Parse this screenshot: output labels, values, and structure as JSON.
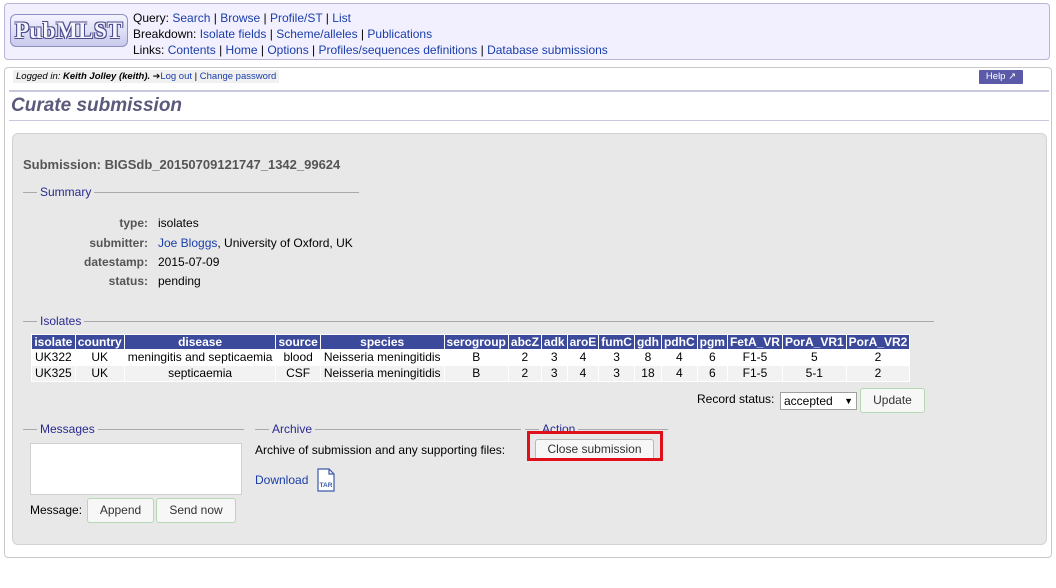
{
  "header": {
    "logo_text": "PubMLST",
    "query_label": "Query:",
    "query_links": [
      "Search",
      "Browse",
      "Profile/ST",
      "List"
    ],
    "breakdown_label": "Breakdown:",
    "breakdown_links": [
      "Isolate fields",
      "Scheme/alleles",
      "Publications"
    ],
    "links_label": "Links:",
    "links_links": [
      "Contents",
      "Home",
      "Options",
      "Profiles/sequences definitions",
      "Database submissions"
    ]
  },
  "userbar": {
    "logged_in_label": "Logged in:",
    "user": "Keith Jolley (keith).",
    "logout": "Log out",
    "change_password": "Change password"
  },
  "help_label": "Help",
  "page_title": "Curate submission",
  "submission_title": "Submission: BIGSdb_20150709121747_1342_99624",
  "summary": {
    "legend": "Summary",
    "type_label": "type:",
    "type_value": "isolates",
    "submitter_label": "submitter:",
    "submitter_name": "Joe Bloggs",
    "submitter_affiliation": ", University of Oxford, UK",
    "datestamp_label": "datestamp:",
    "datestamp_value": "2015-07-09",
    "status_label": "status:",
    "status_value": "pending"
  },
  "isolates": {
    "legend": "Isolates",
    "columns": [
      "isolate",
      "country",
      "disease",
      "source",
      "species",
      "serogroup",
      "abcZ",
      "adk",
      "aroE",
      "fumC",
      "gdh",
      "pdhC",
      "pgm",
      "FetA_VR",
      "PorA_VR1",
      "PorA_VR2"
    ],
    "rows": [
      [
        "UK322",
        "UK",
        "meningitis and septicaemia",
        "blood",
        "Neisseria meningitidis",
        "B",
        "2",
        "3",
        "4",
        "3",
        "8",
        "4",
        "6",
        "F1-5",
        "5",
        "2"
      ],
      [
        "UK325",
        "UK",
        "septicaemia",
        "CSF",
        "Neisseria meningitidis",
        "B",
        "2",
        "3",
        "4",
        "3",
        "18",
        "4",
        "6",
        "F1-5",
        "5-1",
        "2"
      ]
    ],
    "record_status_label": "Record status:",
    "record_status_value": "accepted",
    "update_button": "Update"
  },
  "messages": {
    "legend": "Messages",
    "message_label": "Message:",
    "append_button": "Append",
    "send_button": "Send now"
  },
  "archive": {
    "legend": "Archive",
    "text": "Archive of submission and any supporting files:",
    "download": "Download",
    "icon_text": "TAR"
  },
  "action": {
    "legend": "Action",
    "close_button": "Close submission"
  },
  "colors": {
    "table_header": "#3c4a9c",
    "link": "#1a3ea8",
    "highlight": "#e0101a"
  }
}
